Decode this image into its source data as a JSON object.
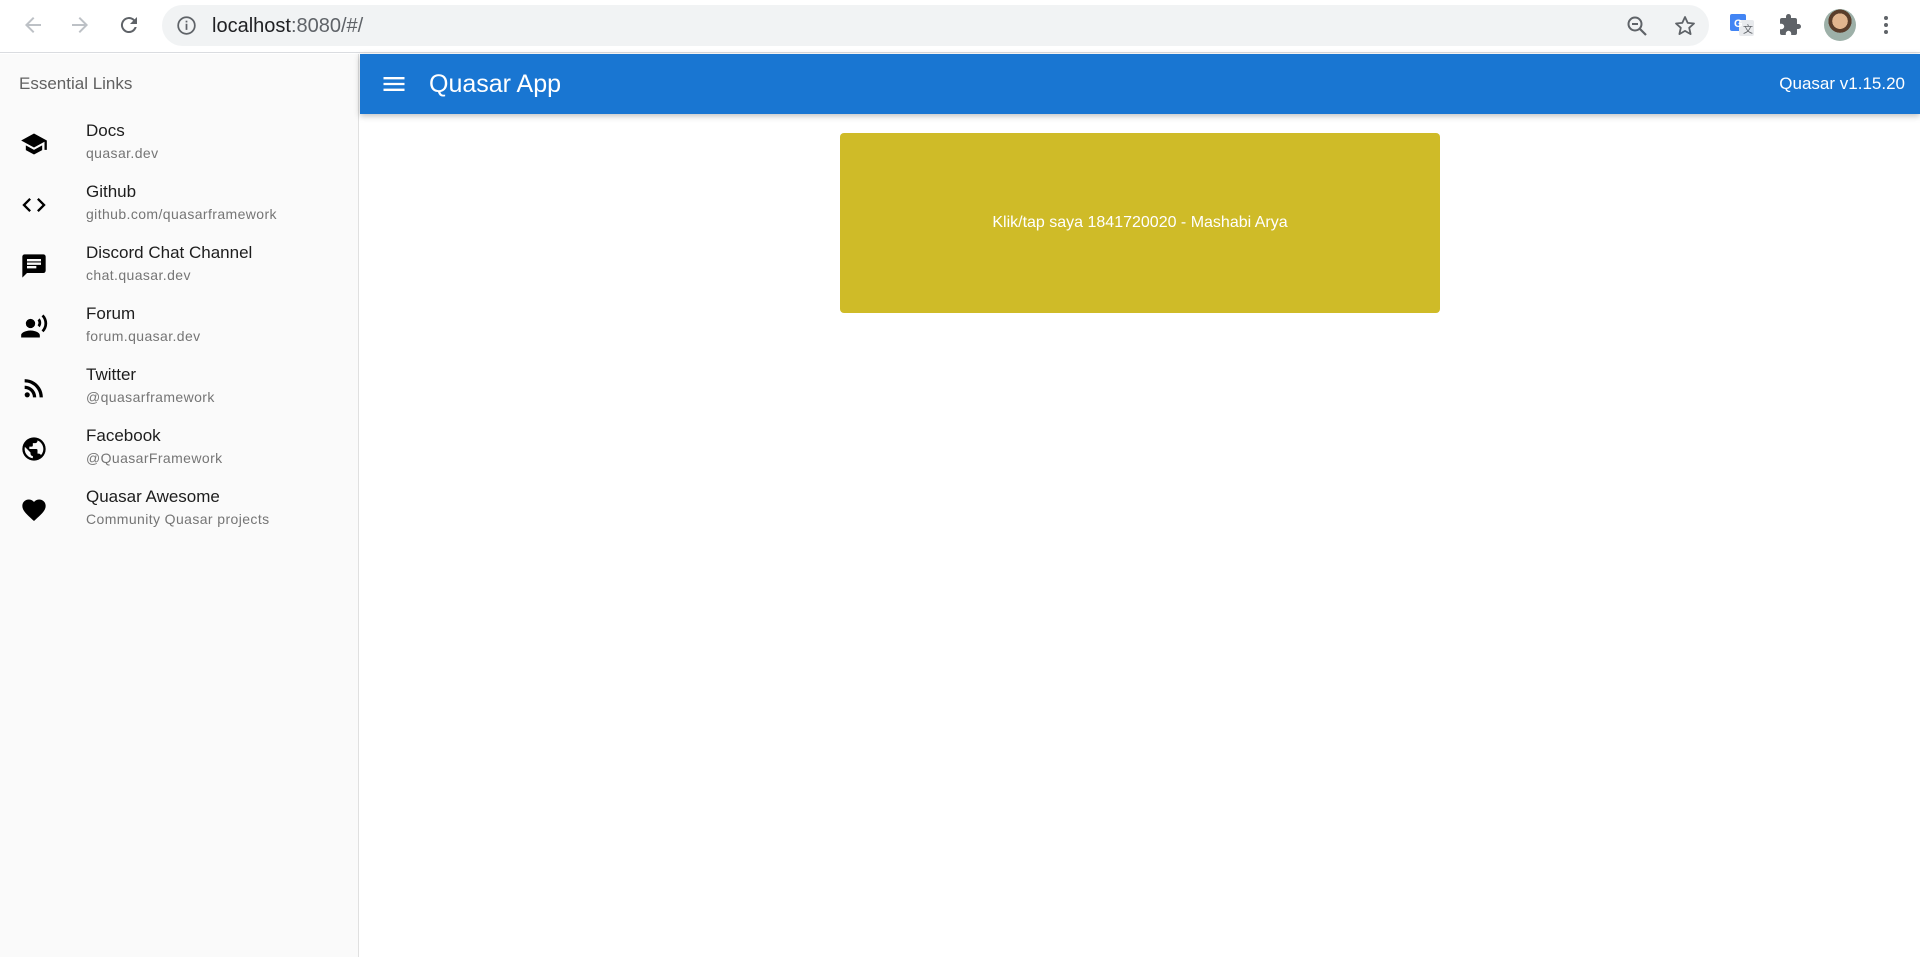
{
  "browser": {
    "url_host": "localhost",
    "url_rest": ":8080/#/"
  },
  "header": {
    "title": "Quasar App",
    "version": "Quasar v1.15.20",
    "color": "#1976d2"
  },
  "sidebar": {
    "heading": "Essential Links",
    "items": [
      {
        "title": "Docs",
        "caption": "quasar.dev",
        "icon": "school-icon"
      },
      {
        "title": "Github",
        "caption": "github.com/quasarframework",
        "icon": "code-icon"
      },
      {
        "title": "Discord Chat Channel",
        "caption": "chat.quasar.dev",
        "icon": "chat-icon"
      },
      {
        "title": "Forum",
        "caption": "forum.quasar.dev",
        "icon": "record-voice-icon"
      },
      {
        "title": "Twitter",
        "caption": "@quasarframework",
        "icon": "rss-feed-icon"
      },
      {
        "title": "Facebook",
        "caption": "@QuasarFramework",
        "icon": "public-icon"
      },
      {
        "title": "Quasar Awesome",
        "caption": "Community Quasar projects",
        "icon": "favorite-icon"
      }
    ]
  },
  "main": {
    "card_text": "Klik/tap saya 1841720020 - Mashabi Arya",
    "card_color": "#cfbb28"
  }
}
